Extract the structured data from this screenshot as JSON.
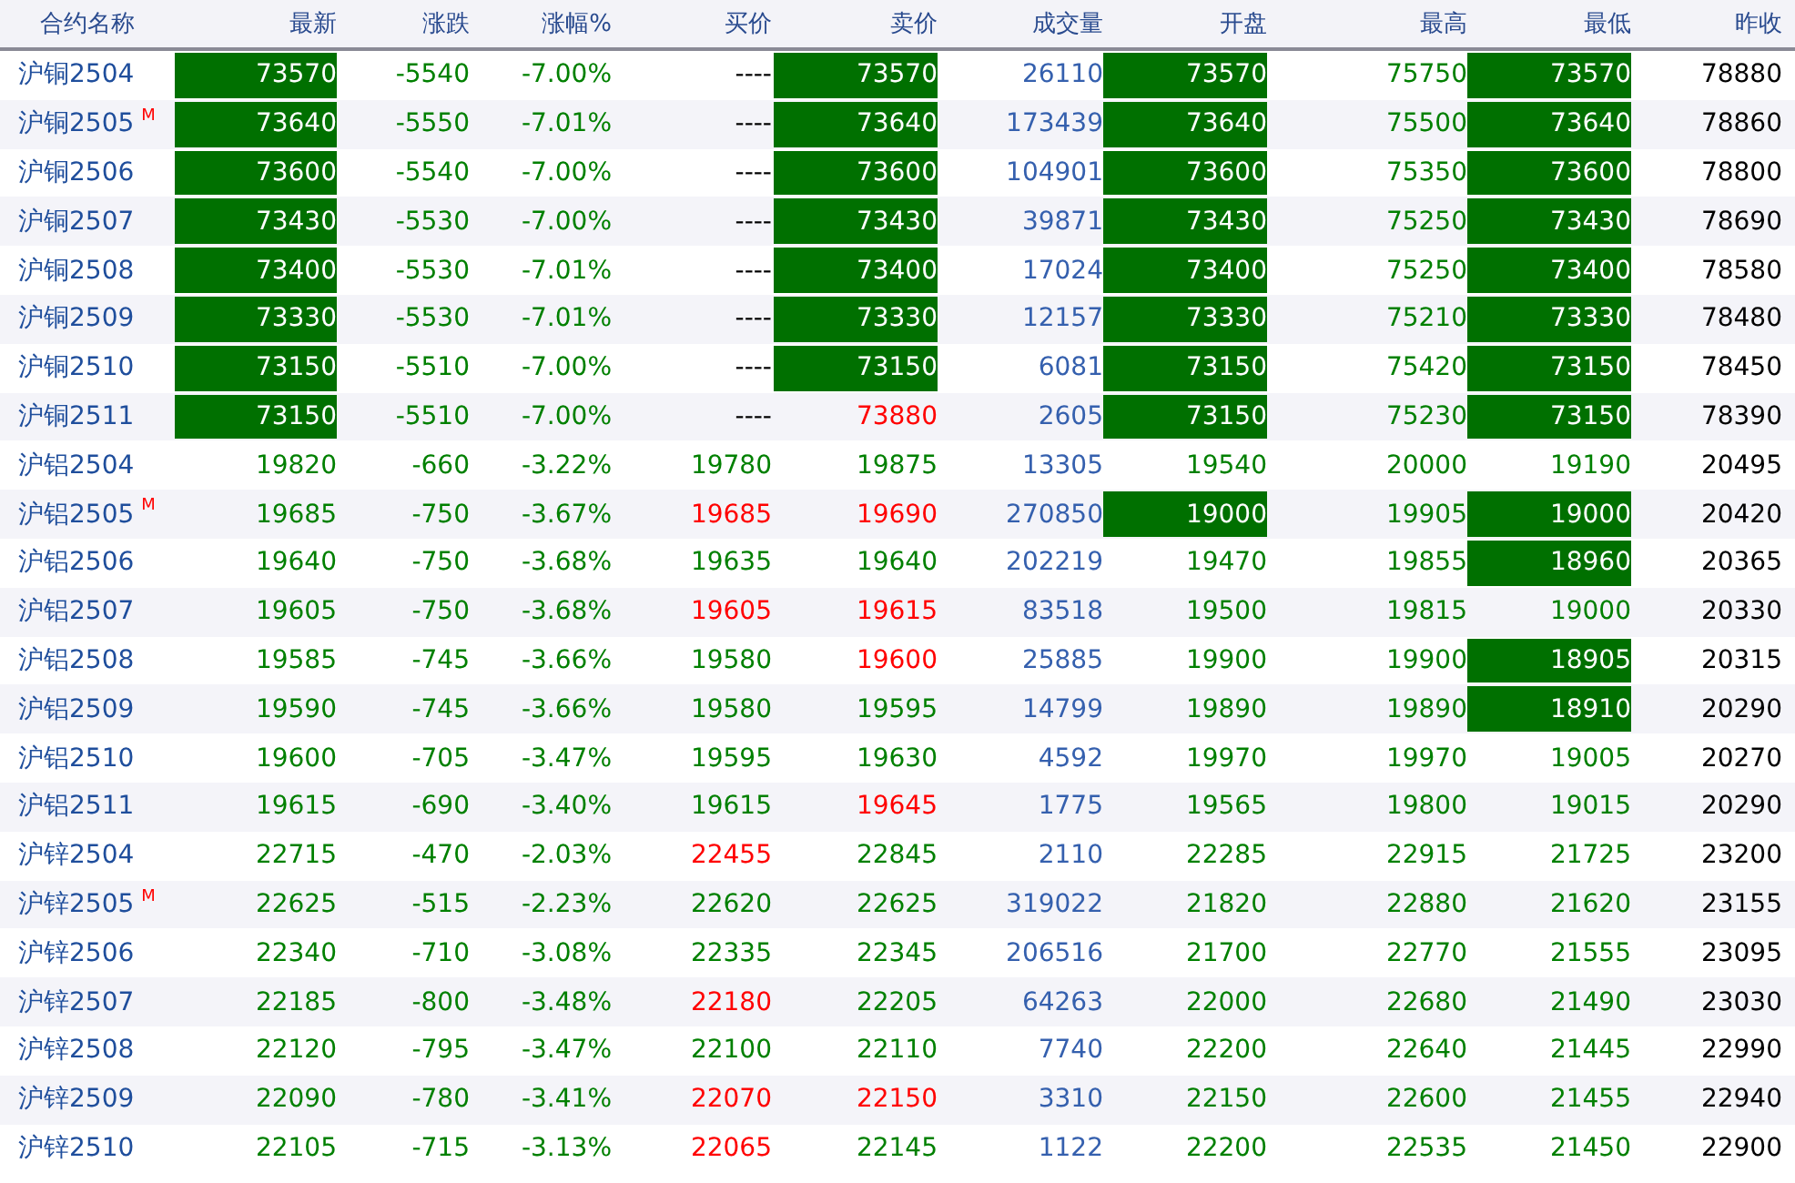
{
  "columns": [
    "合约名称",
    "最新",
    "涨跌",
    "涨幅%",
    "买价",
    "卖价",
    "成交量",
    "开盘",
    "最高",
    "最低",
    "昨收"
  ],
  "rows": [
    {
      "name": "沪铜2504",
      "cells": [
        {
          "text": "73570",
          "limit": true,
          "color": "#007000"
        },
        {
          "text": "-5540",
          "limit": false,
          "color": "#008000"
        },
        {
          "text": "-7.00%",
          "limit": false,
          "color": "#008000"
        },
        {
          "text": "----",
          "limit": false,
          "color": "#000000"
        },
        {
          "text": "73570",
          "limit": true,
          "color": "#007000"
        },
        {
          "text": "26110",
          "limit": false,
          "color": "#3560ae"
        },
        {
          "text": "73570",
          "limit": true,
          "color": "#007000"
        },
        {
          "text": "75750",
          "limit": false,
          "color": "#008000"
        },
        {
          "text": "73570",
          "limit": true,
          "color": "#007000"
        },
        {
          "text": "78880",
          "limit": false,
          "color": "#000000"
        }
      ]
    },
    {
      "name": "沪铜2505",
      "tag": "M",
      "cells": [
        {
          "text": "73640",
          "limit": true,
          "color": "#007000"
        },
        {
          "text": "-5550",
          "limit": false,
          "color": "#008000"
        },
        {
          "text": "-7.01%",
          "limit": false,
          "color": "#008000"
        },
        {
          "text": "----",
          "limit": false,
          "color": "#000000"
        },
        {
          "text": "73640",
          "limit": true,
          "color": "#007000"
        },
        {
          "text": "173439",
          "limit": false,
          "color": "#3560ae"
        },
        {
          "text": "73640",
          "limit": true,
          "color": "#007000"
        },
        {
          "text": "75500",
          "limit": false,
          "color": "#008000"
        },
        {
          "text": "73640",
          "limit": true,
          "color": "#007000"
        },
        {
          "text": "78860",
          "limit": false,
          "color": "#000000"
        }
      ]
    },
    {
      "name": "沪铜2506",
      "cells": [
        {
          "text": "73600",
          "limit": true,
          "color": "#007000"
        },
        {
          "text": "-5540",
          "limit": false,
          "color": "#008000"
        },
        {
          "text": "-7.00%",
          "limit": false,
          "color": "#008000"
        },
        {
          "text": "----",
          "limit": false,
          "color": "#000000"
        },
        {
          "text": "73600",
          "limit": true,
          "color": "#007000"
        },
        {
          "text": "104901",
          "limit": false,
          "color": "#3560ae"
        },
        {
          "text": "73600",
          "limit": true,
          "color": "#007000"
        },
        {
          "text": "75350",
          "limit": false,
          "color": "#008000"
        },
        {
          "text": "73600",
          "limit": true,
          "color": "#007000"
        },
        {
          "text": "78800",
          "limit": false,
          "color": "#000000"
        }
      ]
    },
    {
      "name": "沪铜2507",
      "cells": [
        {
          "text": "73430",
          "limit": true,
          "color": "#007000"
        },
        {
          "text": "-5530",
          "limit": false,
          "color": "#008000"
        },
        {
          "text": "-7.00%",
          "limit": false,
          "color": "#008000"
        },
        {
          "text": "----",
          "limit": false,
          "color": "#000000"
        },
        {
          "text": "73430",
          "limit": true,
          "color": "#007000"
        },
        {
          "text": "39871",
          "limit": false,
          "color": "#3560ae"
        },
        {
          "text": "73430",
          "limit": true,
          "color": "#007000"
        },
        {
          "text": "75250",
          "limit": false,
          "color": "#008000"
        },
        {
          "text": "73430",
          "limit": true,
          "color": "#007000"
        },
        {
          "text": "78690",
          "limit": false,
          "color": "#000000"
        }
      ]
    },
    {
      "name": "沪铜2508",
      "cells": [
        {
          "text": "73400",
          "limit": true,
          "color": "#007000"
        },
        {
          "text": "-5530",
          "limit": false,
          "color": "#008000"
        },
        {
          "text": "-7.01%",
          "limit": false,
          "color": "#008000"
        },
        {
          "text": "----",
          "limit": false,
          "color": "#000000"
        },
        {
          "text": "73400",
          "limit": true,
          "color": "#007000"
        },
        {
          "text": "17024",
          "limit": false,
          "color": "#3560ae"
        },
        {
          "text": "73400",
          "limit": true,
          "color": "#007000"
        },
        {
          "text": "75250",
          "limit": false,
          "color": "#008000"
        },
        {
          "text": "73400",
          "limit": true,
          "color": "#007000"
        },
        {
          "text": "78580",
          "limit": false,
          "color": "#000000"
        }
      ]
    },
    {
      "name": "沪铜2509",
      "cells": [
        {
          "text": "73330",
          "limit": true,
          "color": "#007000"
        },
        {
          "text": "-5530",
          "limit": false,
          "color": "#008000"
        },
        {
          "text": "-7.01%",
          "limit": false,
          "color": "#008000"
        },
        {
          "text": "----",
          "limit": false,
          "color": "#000000"
        },
        {
          "text": "73330",
          "limit": true,
          "color": "#007000"
        },
        {
          "text": "12157",
          "limit": false,
          "color": "#3560ae"
        },
        {
          "text": "73330",
          "limit": true,
          "color": "#007000"
        },
        {
          "text": "75210",
          "limit": false,
          "color": "#008000"
        },
        {
          "text": "73330",
          "limit": true,
          "color": "#007000"
        },
        {
          "text": "78480",
          "limit": false,
          "color": "#000000"
        }
      ]
    },
    {
      "name": "沪铜2510",
      "cells": [
        {
          "text": "73150",
          "limit": true,
          "color": "#007000"
        },
        {
          "text": "-5510",
          "limit": false,
          "color": "#008000"
        },
        {
          "text": "-7.00%",
          "limit": false,
          "color": "#008000"
        },
        {
          "text": "----",
          "limit": false,
          "color": "#000000"
        },
        {
          "text": "73150",
          "limit": true,
          "color": "#007000"
        },
        {
          "text": "6081",
          "limit": false,
          "color": "#3560ae"
        },
        {
          "text": "73150",
          "limit": true,
          "color": "#007000"
        },
        {
          "text": "75420",
          "limit": false,
          "color": "#008000"
        },
        {
          "text": "73150",
          "limit": true,
          "color": "#007000"
        },
        {
          "text": "78450",
          "limit": false,
          "color": "#000000"
        }
      ]
    },
    {
      "name": "沪铜2511",
      "cells": [
        {
          "text": "73150",
          "limit": true,
          "color": "#007000"
        },
        {
          "text": "-5510",
          "limit": false,
          "color": "#008000"
        },
        {
          "text": "-7.00%",
          "limit": false,
          "color": "#008000"
        },
        {
          "text": "----",
          "limit": false,
          "color": "#000000"
        },
        {
          "text": "73880",
          "limit": false,
          "color": "#ff0000"
        },
        {
          "text": "2605",
          "limit": false,
          "color": "#3560ae"
        },
        {
          "text": "73150",
          "limit": true,
          "color": "#007000"
        },
        {
          "text": "75230",
          "limit": false,
          "color": "#008000"
        },
        {
          "text": "73150",
          "limit": true,
          "color": "#007000"
        },
        {
          "text": "78390",
          "limit": false,
          "color": "#000000"
        }
      ]
    },
    {
      "name": "沪铝2504",
      "cells": [
        {
          "text": "19820",
          "limit": false,
          "color": "#008000"
        },
        {
          "text": "-660",
          "limit": false,
          "color": "#008000"
        },
        {
          "text": "-3.22%",
          "limit": false,
          "color": "#008000"
        },
        {
          "text": "19780",
          "limit": false,
          "color": "#008000"
        },
        {
          "text": "19875",
          "limit": false,
          "color": "#008000"
        },
        {
          "text": "13305",
          "limit": false,
          "color": "#3560ae"
        },
        {
          "text": "19540",
          "limit": false,
          "color": "#008000"
        },
        {
          "text": "20000",
          "limit": false,
          "color": "#008000"
        },
        {
          "text": "19190",
          "limit": false,
          "color": "#008000"
        },
        {
          "text": "20495",
          "limit": false,
          "color": "#000000"
        }
      ]
    },
    {
      "name": "沪铝2505",
      "tag": "M",
      "cells": [
        {
          "text": "19685",
          "limit": false,
          "color": "#008000"
        },
        {
          "text": "-750",
          "limit": false,
          "color": "#008000"
        },
        {
          "text": "-3.67%",
          "limit": false,
          "color": "#008000"
        },
        {
          "text": "19685",
          "limit": false,
          "color": "#ff0000"
        },
        {
          "text": "19690",
          "limit": false,
          "color": "#ff0000"
        },
        {
          "text": "270850",
          "limit": false,
          "color": "#3560ae"
        },
        {
          "text": "19000",
          "limit": true,
          "color": "#007000"
        },
        {
          "text": "19905",
          "limit": false,
          "color": "#008000"
        },
        {
          "text": "19000",
          "limit": true,
          "color": "#007000"
        },
        {
          "text": "20420",
          "limit": false,
          "color": "#000000"
        }
      ]
    },
    {
      "name": "沪铝2506",
      "cells": [
        {
          "text": "19640",
          "limit": false,
          "color": "#008000"
        },
        {
          "text": "-750",
          "limit": false,
          "color": "#008000"
        },
        {
          "text": "-3.68%",
          "limit": false,
          "color": "#008000"
        },
        {
          "text": "19635",
          "limit": false,
          "color": "#008000"
        },
        {
          "text": "19640",
          "limit": false,
          "color": "#008000"
        },
        {
          "text": "202219",
          "limit": false,
          "color": "#3560ae"
        },
        {
          "text": "19470",
          "limit": false,
          "color": "#008000"
        },
        {
          "text": "19855",
          "limit": false,
          "color": "#008000"
        },
        {
          "text": "18960",
          "limit": true,
          "color": "#007000"
        },
        {
          "text": "20365",
          "limit": false,
          "color": "#000000"
        }
      ]
    },
    {
      "name": "沪铝2507",
      "cells": [
        {
          "text": "19605",
          "limit": false,
          "color": "#008000"
        },
        {
          "text": "-750",
          "limit": false,
          "color": "#008000"
        },
        {
          "text": "-3.68%",
          "limit": false,
          "color": "#008000"
        },
        {
          "text": "19605",
          "limit": false,
          "color": "#ff0000"
        },
        {
          "text": "19615",
          "limit": false,
          "color": "#ff0000"
        },
        {
          "text": "83518",
          "limit": false,
          "color": "#3560ae"
        },
        {
          "text": "19500",
          "limit": false,
          "color": "#008000"
        },
        {
          "text": "19815",
          "limit": false,
          "color": "#008000"
        },
        {
          "text": "19000",
          "limit": false,
          "color": "#008000"
        },
        {
          "text": "20330",
          "limit": false,
          "color": "#000000"
        }
      ]
    },
    {
      "name": "沪铝2508",
      "cells": [
        {
          "text": "19585",
          "limit": false,
          "color": "#008000"
        },
        {
          "text": "-745",
          "limit": false,
          "color": "#008000"
        },
        {
          "text": "-3.66%",
          "limit": false,
          "color": "#008000"
        },
        {
          "text": "19580",
          "limit": false,
          "color": "#008000"
        },
        {
          "text": "19600",
          "limit": false,
          "color": "#ff0000"
        },
        {
          "text": "25885",
          "limit": false,
          "color": "#3560ae"
        },
        {
          "text": "19900",
          "limit": false,
          "color": "#008000"
        },
        {
          "text": "19900",
          "limit": false,
          "color": "#008000"
        },
        {
          "text": "18905",
          "limit": true,
          "color": "#007000"
        },
        {
          "text": "20315",
          "limit": false,
          "color": "#000000"
        }
      ]
    },
    {
      "name": "沪铝2509",
      "cells": [
        {
          "text": "19590",
          "limit": false,
          "color": "#008000"
        },
        {
          "text": "-745",
          "limit": false,
          "color": "#008000"
        },
        {
          "text": "-3.66%",
          "limit": false,
          "color": "#008000"
        },
        {
          "text": "19580",
          "limit": false,
          "color": "#008000"
        },
        {
          "text": "19595",
          "limit": false,
          "color": "#008000"
        },
        {
          "text": "14799",
          "limit": false,
          "color": "#3560ae"
        },
        {
          "text": "19890",
          "limit": false,
          "color": "#008000"
        },
        {
          "text": "19890",
          "limit": false,
          "color": "#008000"
        },
        {
          "text": "18910",
          "limit": true,
          "color": "#007000"
        },
        {
          "text": "20290",
          "limit": false,
          "color": "#000000"
        }
      ]
    },
    {
      "name": "沪铝2510",
      "cells": [
        {
          "text": "19600",
          "limit": false,
          "color": "#008000"
        },
        {
          "text": "-705",
          "limit": false,
          "color": "#008000"
        },
        {
          "text": "-3.47%",
          "limit": false,
          "color": "#008000"
        },
        {
          "text": "19595",
          "limit": false,
          "color": "#008000"
        },
        {
          "text": "19630",
          "limit": false,
          "color": "#008000"
        },
        {
          "text": "4592",
          "limit": false,
          "color": "#3560ae"
        },
        {
          "text": "19970",
          "limit": false,
          "color": "#008000"
        },
        {
          "text": "19970",
          "limit": false,
          "color": "#008000"
        },
        {
          "text": "19005",
          "limit": false,
          "color": "#008000"
        },
        {
          "text": "20270",
          "limit": false,
          "color": "#000000"
        }
      ]
    },
    {
      "name": "沪铝2511",
      "cells": [
        {
          "text": "19615",
          "limit": false,
          "color": "#008000"
        },
        {
          "text": "-690",
          "limit": false,
          "color": "#008000"
        },
        {
          "text": "-3.40%",
          "limit": false,
          "color": "#008000"
        },
        {
          "text": "19615",
          "limit": false,
          "color": "#008000"
        },
        {
          "text": "19645",
          "limit": false,
          "color": "#ff0000"
        },
        {
          "text": "1775",
          "limit": false,
          "color": "#3560ae"
        },
        {
          "text": "19565",
          "limit": false,
          "color": "#008000"
        },
        {
          "text": "19800",
          "limit": false,
          "color": "#008000"
        },
        {
          "text": "19015",
          "limit": false,
          "color": "#008000"
        },
        {
          "text": "20290",
          "limit": false,
          "color": "#000000"
        }
      ]
    },
    {
      "name": "沪锌2504",
      "cells": [
        {
          "text": "22715",
          "limit": false,
          "color": "#008000"
        },
        {
          "text": "-470",
          "limit": false,
          "color": "#008000"
        },
        {
          "text": "-2.03%",
          "limit": false,
          "color": "#008000"
        },
        {
          "text": "22455",
          "limit": false,
          "color": "#ff0000"
        },
        {
          "text": "22845",
          "limit": false,
          "color": "#008000"
        },
        {
          "text": "2110",
          "limit": false,
          "color": "#3560ae"
        },
        {
          "text": "22285",
          "limit": false,
          "color": "#008000"
        },
        {
          "text": "22915",
          "limit": false,
          "color": "#008000"
        },
        {
          "text": "21725",
          "limit": false,
          "color": "#008000"
        },
        {
          "text": "23200",
          "limit": false,
          "color": "#000000"
        }
      ]
    },
    {
      "name": "沪锌2505",
      "tag": "M",
      "cells": [
        {
          "text": "22625",
          "limit": false,
          "color": "#008000"
        },
        {
          "text": "-515",
          "limit": false,
          "color": "#008000"
        },
        {
          "text": "-2.23%",
          "limit": false,
          "color": "#008000"
        },
        {
          "text": "22620",
          "limit": false,
          "color": "#008000"
        },
        {
          "text": "22625",
          "limit": false,
          "color": "#008000"
        },
        {
          "text": "319022",
          "limit": false,
          "color": "#3560ae"
        },
        {
          "text": "21820",
          "limit": false,
          "color": "#008000"
        },
        {
          "text": "22880",
          "limit": false,
          "color": "#008000"
        },
        {
          "text": "21620",
          "limit": false,
          "color": "#008000"
        },
        {
          "text": "23155",
          "limit": false,
          "color": "#000000"
        }
      ]
    },
    {
      "name": "沪锌2506",
      "cells": [
        {
          "text": "22340",
          "limit": false,
          "color": "#008000"
        },
        {
          "text": "-710",
          "limit": false,
          "color": "#008000"
        },
        {
          "text": "-3.08%",
          "limit": false,
          "color": "#008000"
        },
        {
          "text": "22335",
          "limit": false,
          "color": "#008000"
        },
        {
          "text": "22345",
          "limit": false,
          "color": "#008000"
        },
        {
          "text": "206516",
          "limit": false,
          "color": "#3560ae"
        },
        {
          "text": "21700",
          "limit": false,
          "color": "#008000"
        },
        {
          "text": "22770",
          "limit": false,
          "color": "#008000"
        },
        {
          "text": "21555",
          "limit": false,
          "color": "#008000"
        },
        {
          "text": "23095",
          "limit": false,
          "color": "#000000"
        }
      ]
    },
    {
      "name": "沪锌2507",
      "cells": [
        {
          "text": "22185",
          "limit": false,
          "color": "#008000"
        },
        {
          "text": "-800",
          "limit": false,
          "color": "#008000"
        },
        {
          "text": "-3.48%",
          "limit": false,
          "color": "#008000"
        },
        {
          "text": "22180",
          "limit": false,
          "color": "#ff0000"
        },
        {
          "text": "22205",
          "limit": false,
          "color": "#008000"
        },
        {
          "text": "64263",
          "limit": false,
          "color": "#3560ae"
        },
        {
          "text": "22000",
          "limit": false,
          "color": "#008000"
        },
        {
          "text": "22680",
          "limit": false,
          "color": "#008000"
        },
        {
          "text": "21490",
          "limit": false,
          "color": "#008000"
        },
        {
          "text": "23030",
          "limit": false,
          "color": "#000000"
        }
      ]
    },
    {
      "name": "沪锌2508",
      "cells": [
        {
          "text": "22120",
          "limit": false,
          "color": "#008000"
        },
        {
          "text": "-795",
          "limit": false,
          "color": "#008000"
        },
        {
          "text": "-3.47%",
          "limit": false,
          "color": "#008000"
        },
        {
          "text": "22100",
          "limit": false,
          "color": "#008000"
        },
        {
          "text": "22110",
          "limit": false,
          "color": "#008000"
        },
        {
          "text": "7740",
          "limit": false,
          "color": "#3560ae"
        },
        {
          "text": "22200",
          "limit": false,
          "color": "#008000"
        },
        {
          "text": "22640",
          "limit": false,
          "color": "#008000"
        },
        {
          "text": "21445",
          "limit": false,
          "color": "#008000"
        },
        {
          "text": "22990",
          "limit": false,
          "color": "#000000"
        }
      ]
    },
    {
      "name": "沪锌2509",
      "cells": [
        {
          "text": "22090",
          "limit": false,
          "color": "#008000"
        },
        {
          "text": "-780",
          "limit": false,
          "color": "#008000"
        },
        {
          "text": "-3.41%",
          "limit": false,
          "color": "#008000"
        },
        {
          "text": "22070",
          "limit": false,
          "color": "#ff0000"
        },
        {
          "text": "22150",
          "limit": false,
          "color": "#ff0000"
        },
        {
          "text": "3310",
          "limit": false,
          "color": "#3560ae"
        },
        {
          "text": "22150",
          "limit": false,
          "color": "#008000"
        },
        {
          "text": "22600",
          "limit": false,
          "color": "#008000"
        },
        {
          "text": "21455",
          "limit": false,
          "color": "#008000"
        },
        {
          "text": "22940",
          "limit": false,
          "color": "#000000"
        }
      ]
    },
    {
      "name": "沪锌2510",
      "cells": [
        {
          "text": "22105",
          "limit": false,
          "color": "#008000"
        },
        {
          "text": "-715",
          "limit": false,
          "color": "#008000"
        },
        {
          "text": "-3.13%",
          "limit": false,
          "color": "#008000"
        },
        {
          "text": "22065",
          "limit": false,
          "color": "#ff0000"
        },
        {
          "text": "22145",
          "limit": false,
          "color": "#008000"
        },
        {
          "text": "1122",
          "limit": false,
          "color": "#3560ae"
        },
        {
          "text": "22200",
          "limit": false,
          "color": "#008000"
        },
        {
          "text": "22535",
          "limit": false,
          "color": "#008000"
        },
        {
          "text": "21450",
          "limit": false,
          "color": "#008000"
        },
        {
          "text": "22900",
          "limit": false,
          "color": "#000000"
        }
      ]
    }
  ]
}
